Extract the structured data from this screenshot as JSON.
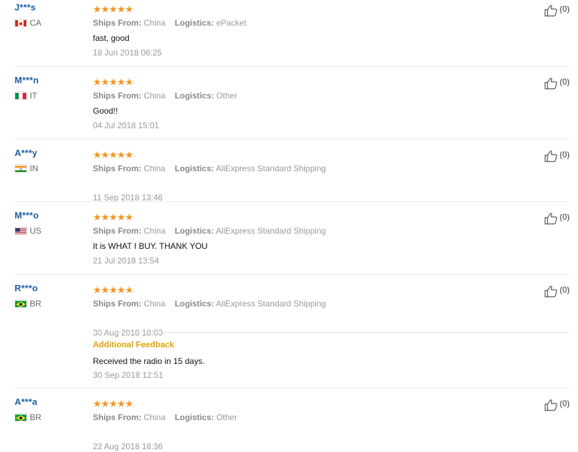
{
  "labels": {
    "ships_from": "Ships From:",
    "logistics": "Logistics:",
    "additional_feedback": "Additional Feedback"
  },
  "stars_count": 5,
  "colors": {
    "user": "#1a5ea8",
    "star": "#f7931e",
    "additional": "#e6a100"
  },
  "reviews": [
    {
      "user": "J***s",
      "country": "CA",
      "flag": "ca",
      "ships_from": "China",
      "logistics": "ePacket",
      "text": "fast, good",
      "date": "18 Jun 2018 06:25",
      "likes": "(0)"
    },
    {
      "user": "M***n",
      "country": "IT",
      "flag": "it",
      "ships_from": "China",
      "logistics": "Other",
      "text": "Good!!",
      "date": "04 Jul 2018 15:01",
      "likes": "(0)"
    },
    {
      "user": "A***y",
      "country": "IN",
      "flag": "in",
      "ships_from": "China",
      "logistics": "AliExpress Standard Shipping",
      "text": "",
      "date": "11 Sep 2018 13:46",
      "likes": "(0)"
    },
    {
      "user": "M***o",
      "country": "US",
      "flag": "us",
      "ships_from": "China",
      "logistics": "AliExpress Standard Shipping",
      "text": "It is WHAT I BUY. THANK YOU",
      "date": "21 Jul 2018 13:54",
      "likes": "(0)"
    },
    {
      "user": "R***o",
      "country": "BR",
      "flag": "br",
      "ships_from": "China",
      "logistics": "AliExpress Standard Shipping",
      "text": "",
      "date": "30 Aug 2018 18:03",
      "likes": "(0)",
      "additional": {
        "text": "Received the radio in 15 days.",
        "date": "30 Sep 2018 12:51"
      }
    },
    {
      "user": "A***a",
      "country": "BR",
      "flag": "br",
      "ships_from": "China",
      "logistics": "Other",
      "text": "",
      "date": "22 Aug 2018 18:36",
      "likes": "(0)"
    }
  ]
}
